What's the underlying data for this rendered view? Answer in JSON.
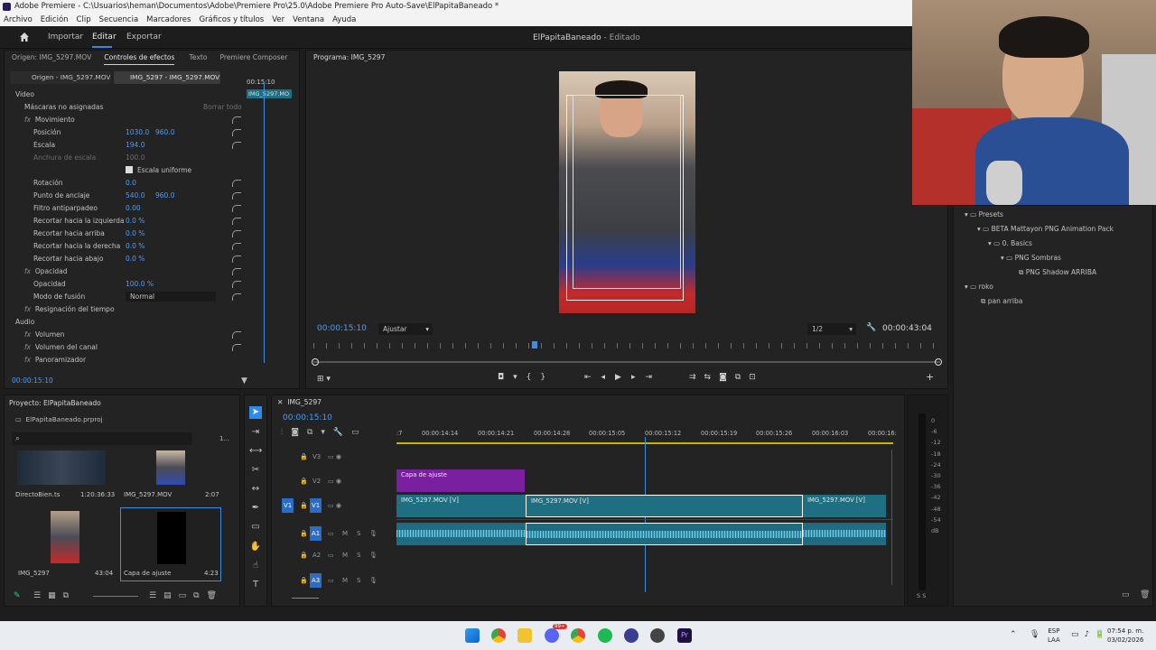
{
  "window": {
    "title": "Adobe Premiere - C:\\Usuarios\\heman\\Documentos\\Adobe\\Premiere Pro\\25.0\\Adobe Premiere Pro Auto-Save\\ElPapitaBaneado *",
    "menu": [
      "Archivo",
      "Edición",
      "Clip",
      "Secuencia",
      "Marcadores",
      "Gráficos y títulos",
      "Ver",
      "Ventana",
      "Ayuda"
    ]
  },
  "topbar": {
    "nav": [
      "Importar",
      "Editar",
      "Exportar"
    ],
    "active": "Editar",
    "doc_title": "ElPapitaBaneado",
    "doc_status": "- Editado"
  },
  "effects_panel": {
    "tabs": [
      "Origen: IMG_5297.MOV",
      "Controles de efectos",
      "Texto",
      "Premiere Composer"
    ],
    "source_tab": "Origen - IMG_5297.MOV",
    "sequence_tab": "IMG_5297 - IMG_5297.MOV",
    "mini_time": "00:15:10",
    "mini_clip": "IMG_5297.MO",
    "section_video": "Video",
    "masks": "Máscaras no asignadas",
    "clear_all": "Borrar todo",
    "motion": "Movimiento",
    "position": {
      "label": "Posición",
      "x": "1030.0",
      "y": "960.0"
    },
    "scale": {
      "label": "Escala",
      "value": "194.0"
    },
    "scale_width": {
      "label": "Anchura de escala",
      "value": "100.0"
    },
    "uniform_scale": "Escala uniforme",
    "rotation": {
      "label": "Rotación",
      "value": "0.0"
    },
    "anchor": {
      "label": "Punto de anclaje",
      "x": "540.0",
      "y": "960.0"
    },
    "flicker": {
      "label": "Filtro antiparpadeo",
      "value": "0.00"
    },
    "crop_left": {
      "label": "Recortar hacia la izquierda",
      "value": "0.0 %"
    },
    "crop_top": {
      "label": "Recortar hacia arriba",
      "value": "0.0 %"
    },
    "crop_right": {
      "label": "Recortar hacia la derecha",
      "value": "0.0 %"
    },
    "crop_bottom": {
      "label": "Recortar hacia abajo",
      "value": "0.0 %"
    },
    "opacity_group": "Opacidad",
    "opacity": {
      "label": "Opacidad",
      "value": "100.0 %"
    },
    "blend": {
      "label": "Modo de fusión",
      "value": "Normal"
    },
    "time_remap": "Resignación del tiempo",
    "section_audio": "Audio",
    "volume": "Volumen",
    "channel_volume": "Volumen del canal",
    "panner": "Panoramizador",
    "timecode": "00:00:15:10"
  },
  "program": {
    "tab": "Programa: IMG_5297",
    "timecode": "00:00:15:10",
    "fit": "Ajustar",
    "resolution": "1/2",
    "duration": "00:00:43:04"
  },
  "project": {
    "tab": "Proyecto: ElPapitaBaneado",
    "file": "ElPapitaBaneado.prproj",
    "page": "1...",
    "items": [
      {
        "name": "DirectoBien.ts",
        "duration": "1:20:36:33"
      },
      {
        "name": "IMG_5297.MOV",
        "duration": "2:07"
      },
      {
        "name": "IMG_5297",
        "duration": "43:04"
      },
      {
        "name": "Capa de ajuste",
        "duration": "4:23"
      }
    ]
  },
  "timeline": {
    "tab": "IMG_5297",
    "timecode": "00:00:15:10",
    "ruler": [
      ":7",
      "00:00:14:14",
      "00:00:14:21",
      "00:00:14:28",
      "00:00:15:05",
      "00:00:15:12",
      "00:00:15:19",
      "00:00:15:26",
      "00:00:16:03",
      "00:00:16:"
    ],
    "video_tracks": [
      "V3",
      "V2",
      "V1"
    ],
    "audio_tracks": [
      "A1",
      "A2",
      "A3"
    ],
    "source_patch_v": "V1",
    "adjustment_clip": "Capa de ajuste",
    "clips_v1": [
      "IMG_5297.MOV [V]",
      "IMG_5297.MOV [V]",
      "IMG_5297.MOV [V]"
    ],
    "m_label": "M",
    "s_label": "S"
  },
  "meter_scale": [
    "0",
    "-6",
    "-12",
    "-18",
    "-24",
    "-30",
    "-36",
    "-42",
    "-48",
    "-54",
    "dB"
  ],
  "meter_bottom": "S S",
  "effects_browser": {
    "items": [
      "Presets",
      "BETA Mattayon PNG Animation Pack",
      "0. Basics",
      "PNG Sombras",
      "PNG Shadow ARRIBA",
      "roko",
      "pan arriba"
    ]
  },
  "taskbar": {
    "lang1": "ESP",
    "lang2": "LAA",
    "time": "07:54 p. m.",
    "date": "03/02/2026",
    "badge": "99+"
  },
  "colors": {
    "accent": "#2d8ceb",
    "clip_video": "#1e6f82",
    "clip_adjust": "#7a1fa0",
    "clip_audio": "#1f6b80",
    "playhead": "#3f8de0"
  }
}
